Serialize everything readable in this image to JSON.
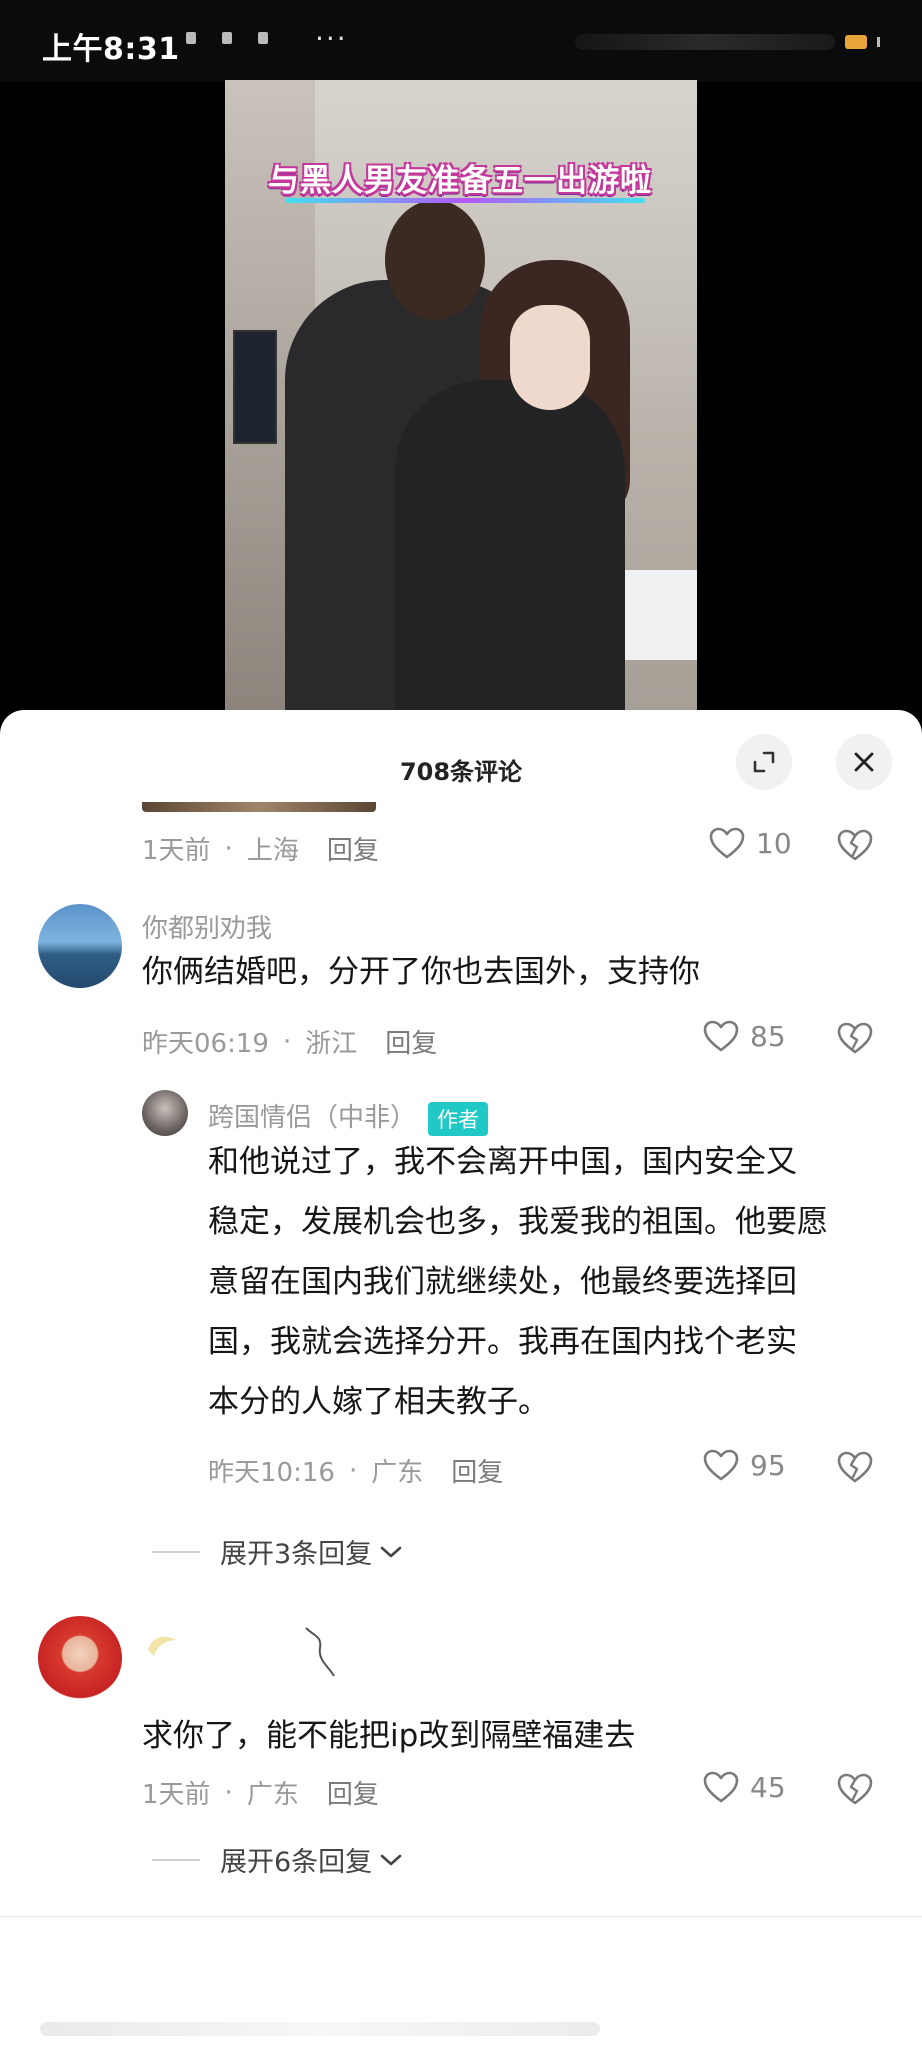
{
  "status_bar": {
    "time": "上午8:31",
    "dots": "···",
    "battery_color": "#e7a53a"
  },
  "video": {
    "banner_text": "与黑人男友准备五一出游啦"
  },
  "comments_sheet": {
    "title": "708条评论",
    "expand_icon": "expand-icon",
    "close_icon": "close-icon",
    "top_partial": {
      "time": "1天前",
      "location": "上海",
      "reply": "回复",
      "likes": "10"
    },
    "comments": [
      {
        "user": "你都别劝我",
        "text": "你俩结婚吧，分开了你也去国外，支持你",
        "time": "昨天06:19",
        "location": "浙江",
        "reply": "回复",
        "likes": "85",
        "replies": [
          {
            "user": "跨国情侣（中非）",
            "badge": "作者",
            "text_lines": [
              "和他说过了，我不会离开中国，国内安全又",
              "稳定，发展机会也多，我爱我的祖国。他要愿",
              "意留在国内我们就继续处，他最终要选择回",
              "国，我就会选择分开。我再在国内找个老实",
              "本分的人嫁了相夫教子。"
            ],
            "time": "昨天10:16",
            "location": "广东",
            "reply": "回复",
            "likes": "95"
          }
        ],
        "expand_label": "展开3条回复"
      },
      {
        "user": "",
        "text": "求你了，能不能把ip改到隔壁福建去",
        "time": "1天前",
        "location": "广东",
        "reply": "回复",
        "likes": "45",
        "expand_label": "展开6条回复"
      }
    ],
    "colors": {
      "author_badge": "#20c9c6",
      "meta_text": "#9a9a9a",
      "body_text": "#161616"
    }
  }
}
